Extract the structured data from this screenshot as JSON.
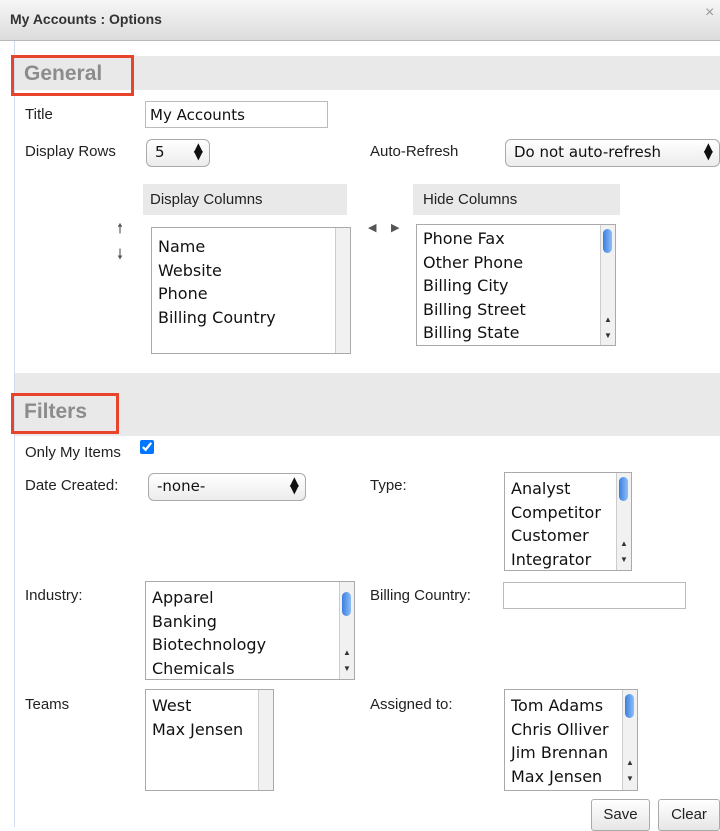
{
  "window": {
    "title": "My Accounts : Options",
    "close_label": "×"
  },
  "general": {
    "section_title": "General",
    "title_label": "Title",
    "title_value": "My Accounts",
    "display_rows_label": "Display Rows",
    "display_rows_value": "5",
    "auto_refresh_label": "Auto-Refresh",
    "auto_refresh_value": "Do not auto-refresh",
    "display_columns_header": "Display Columns",
    "hide_columns_header": "Hide Columns",
    "display_columns": [
      "Name",
      "Website",
      "Phone",
      "Billing Country"
    ],
    "hide_columns": [
      "Phone Fax",
      "Other Phone",
      "Billing City",
      "Billing Street",
      "Billing State"
    ]
  },
  "filters": {
    "section_title": "Filters",
    "only_my_items_label": "Only My Items",
    "only_my_items_checked": true,
    "date_created_label": "Date Created:",
    "date_created_value": "-none-",
    "type_label": "Type:",
    "type_options": [
      "Analyst",
      "Competitor",
      "Customer",
      "Integrator"
    ],
    "industry_label": "Industry:",
    "industry_options": [
      "Apparel",
      "Banking",
      "Biotechnology",
      "Chemicals"
    ],
    "billing_country_label": "Billing Country:",
    "billing_country_value": "",
    "teams_label": "Teams",
    "teams_options": [
      "West",
      "Max Jensen"
    ],
    "assigned_to_label": "Assigned to:",
    "assigned_to_options": [
      "Tom Adams",
      "Chris Olliver",
      "Jim Brennan",
      "Max Jensen"
    ]
  },
  "footer": {
    "save_label": "Save",
    "clear_label": "Clear"
  },
  "colors": {
    "highlight": "#e8442c",
    "band": "#e9e9e9",
    "scroll_thumb": "#3a7fe0"
  }
}
